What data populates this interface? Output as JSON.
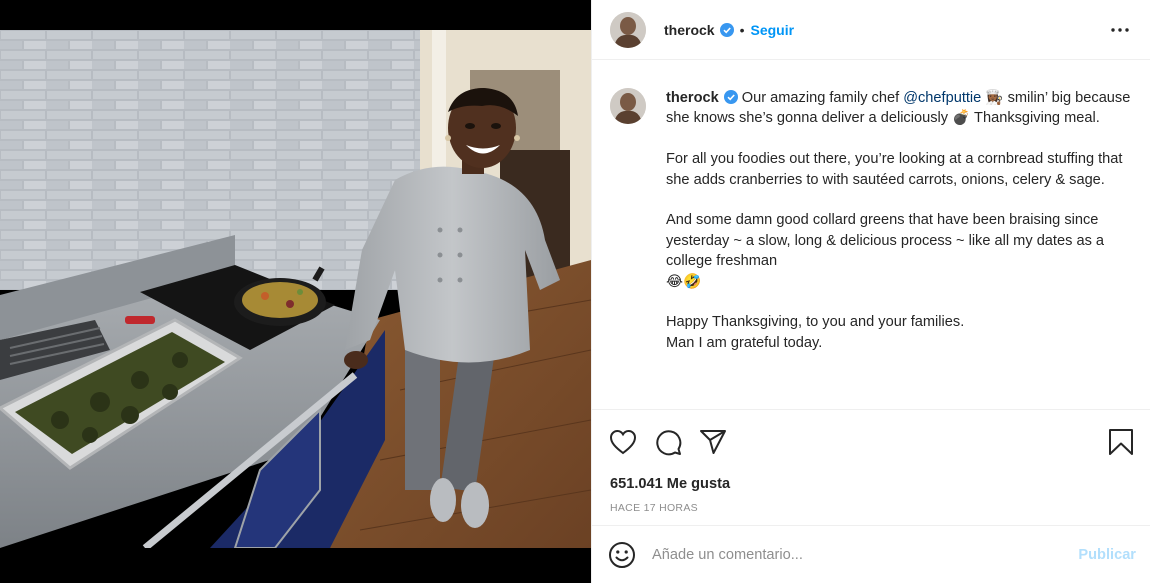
{
  "post": {
    "username": "therock",
    "verified": true,
    "separator": "•",
    "follow_label": "Seguir",
    "more_icon": "more-horizontal-icon"
  },
  "caption": {
    "username": "therock",
    "intro_prefix": "Our amazing family chef ",
    "mention": "@chefputtie",
    "intro_suffix": " 👩🏾‍🍳 smilin’ big because she knows she’s gonna deliver a deliciously 💣 Thanksgiving meal.",
    "paragraph_2": "For all you foodies out there, you’re looking at a cornbread stuffing that she adds cranberries to with sautéed carrots, onions, celery & sage.",
    "paragraph_3": "And some damn good collard greens that have been braising since yesterday ~ a slow, long & delicious process ~ like all my dates as a college freshman",
    "paragraph_3_emoji": "😂🤣",
    "paragraph_4_line_1": "Happy Thanksgiving, to you and your families.",
    "paragraph_4_line_2": "Man I am grateful today."
  },
  "actions": {
    "like_icon": "heart-icon",
    "comment_icon": "comment-icon",
    "share_icon": "paper-plane-icon",
    "save_icon": "bookmark-icon"
  },
  "stats": {
    "likes": "651.041 Me gusta",
    "timestamp": "HACE 17 HORAS"
  },
  "comment": {
    "placeholder": "Añade un comentario...",
    "publish_label": "Publicar",
    "emoji_icon": "smiley-icon"
  },
  "colors": {
    "link_blue": "#0095f6",
    "mention_blue": "#00376b",
    "publish_disabled": "#b2dffc",
    "verified_blue": "#3897f0",
    "muted_gray": "#8e8e8e"
  }
}
